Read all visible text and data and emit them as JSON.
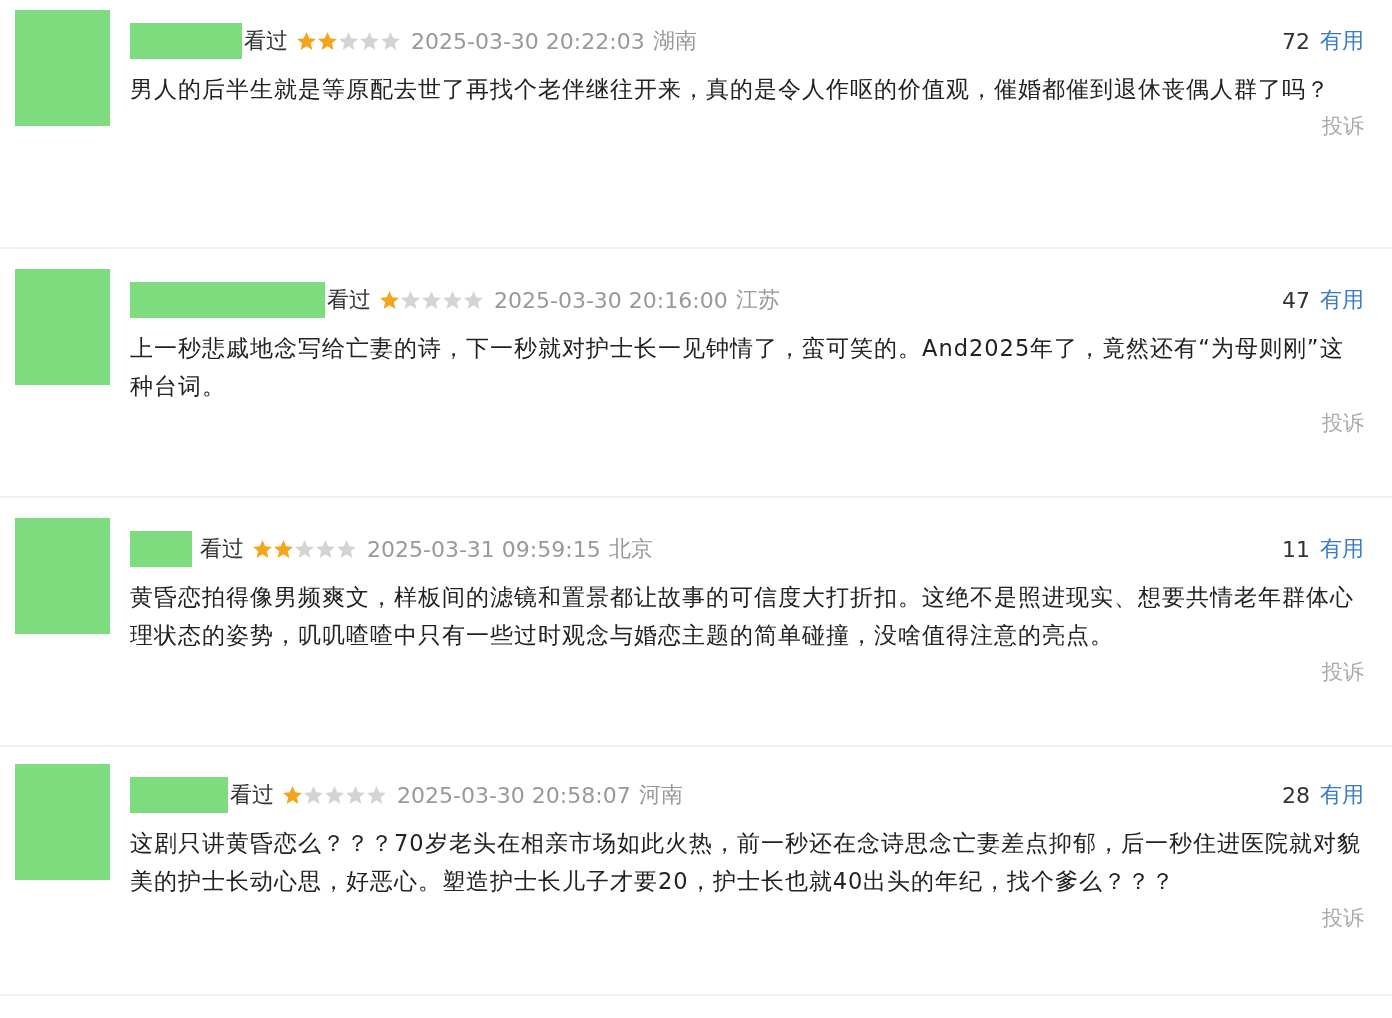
{
  "reviews": [
    {
      "status": "看过",
      "stars": 2,
      "time": "2025-03-30 20:22:03",
      "region": "湖南",
      "votes": "72",
      "useful": "有用",
      "text": "男人的后半生就是等原配去世了再找个老伴继往开来，真的是令人作呕的价值观，催婚都催到退休丧偶人群了吗？",
      "report": "投诉"
    },
    {
      "status": "看过",
      "stars": 1,
      "time": "2025-03-30 20:16:00",
      "region": "江苏",
      "votes": "47",
      "useful": "有用",
      "text": "上一秒悲戚地念写给亡妻的诗，下一秒就对护士长一见钟情了，蛮可笑的。And2025年了，竟然还有“为母则刚”这种台词。",
      "report": "投诉"
    },
    {
      "status": "看过",
      "stars": 2,
      "time": "2025-03-31 09:59:15",
      "region": "北京",
      "votes": "11",
      "useful": "有用",
      "text": "黄昏恋拍得像男频爽文，样板间的滤镜和置景都让故事的可信度大打折扣。这绝不是照进现实、想要共情老年群体心理状态的姿势，叽叽喳喳中只有一些过时观念与婚恋主题的简单碰撞，没啥值得注意的亮点。",
      "report": "投诉"
    },
    {
      "status": "看过",
      "stars": 1,
      "time": "2025-03-30 20:58:07",
      "region": "河南",
      "votes": "28",
      "useful": "有用",
      "text": "这剧只讲黄昏恋么？？？70岁老头在相亲市场如此火热，前一秒还在念诗思念亡妻差点抑郁，后一秒住进医院就对貌美的护士长动心思，好恶心。塑造护士长儿子才要20，护士长也就40出头的年纪，找个爹么？？？",
      "report": "投诉"
    }
  ]
}
